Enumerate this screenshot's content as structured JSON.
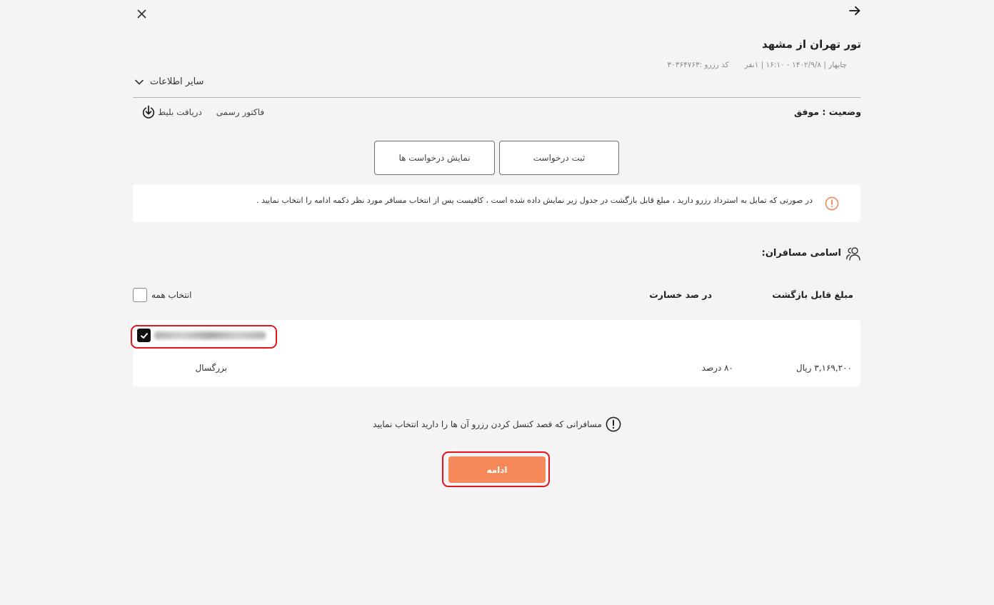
{
  "icons": {
    "back": "arrow-right-icon",
    "close": "close-icon",
    "more_info": "chevron-down-icon",
    "download": "download-icon",
    "notice": "warning-circle-icon",
    "passengers": "users-icon",
    "hint": "info-circle-icon",
    "checkbox_check": "check-icon"
  },
  "colors": {
    "accent": "#f5895a",
    "highlight": "#e3141b",
    "page_background": "#f4f4f4",
    "notice_icon": "#f0845a"
  },
  "header": {
    "title": "تور تهران از مشهد",
    "trip_info": "چابهار | ۱۴۰۲/۹/۸ - ۱۶:۱۰ | ۱نفر",
    "reservation_code": "کد رزرو :۳۰۳۶۴۷۶۳",
    "more_info_label": "سایر اطلاعات"
  },
  "booking": {
    "status": "وضعیت : موفق",
    "invoice_label": "فاکتور رسمی",
    "download_ticket_label": "دریافت بلیط"
  },
  "requests": {
    "submit_label": "ثبت درخواست",
    "show_label": "نمایش درخواست ها"
  },
  "notice": {
    "text": "در صورتی که تمایل به استرداد رزرو دارید ، مبلغ قابل بازگشت در جدول زیر نمایش داده شده است ، کافیست پس از انتخاب مسافر مورد نظر دکمه ادامه را انتخاب نمایید ."
  },
  "passengers": {
    "title": "اسامی مسافران:",
    "columns": {
      "refund_amount": "مبلغ قابل بازگشت",
      "penalty": "در صد خسارت"
    },
    "select_all": {
      "label": "انتخاب همه",
      "checked": false
    },
    "rows": [
      {
        "selected": true,
        "refund_amount": "۳,۱۶۹,۲۰۰ ریال",
        "penalty": "۸۰ درصد",
        "passenger_type": "بزرگسال"
      }
    ]
  },
  "hint": {
    "text": "مسافرانی که قصد کنسل کردن رزرو آن ها را دارید انتخاب نمایید"
  },
  "continue_button": {
    "label": "ادامه"
  }
}
